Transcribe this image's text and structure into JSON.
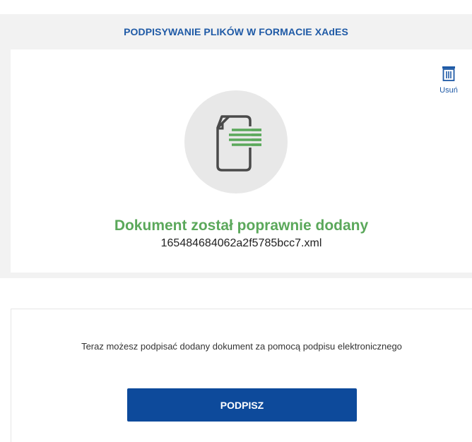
{
  "header": {
    "title": "PODPISYWANIE PLIKÓW W FORMACIE XAdES"
  },
  "upload": {
    "delete_label": "Usuń",
    "status": "Dokument został poprawnie dodany",
    "filename": "165484684062a2f5785bcc7.xml",
    "doc_icon": "document-icon",
    "delete_icon": "trash-icon"
  },
  "sign": {
    "instruction": "Teraz możesz podpisać dodany dokument za pomocą podpisu elektronicznego",
    "button_label": "PODPISZ"
  },
  "colors": {
    "accent_blue": "#1f5aa6",
    "button_blue": "#0d4a9b",
    "success_green": "#5ba85b"
  }
}
